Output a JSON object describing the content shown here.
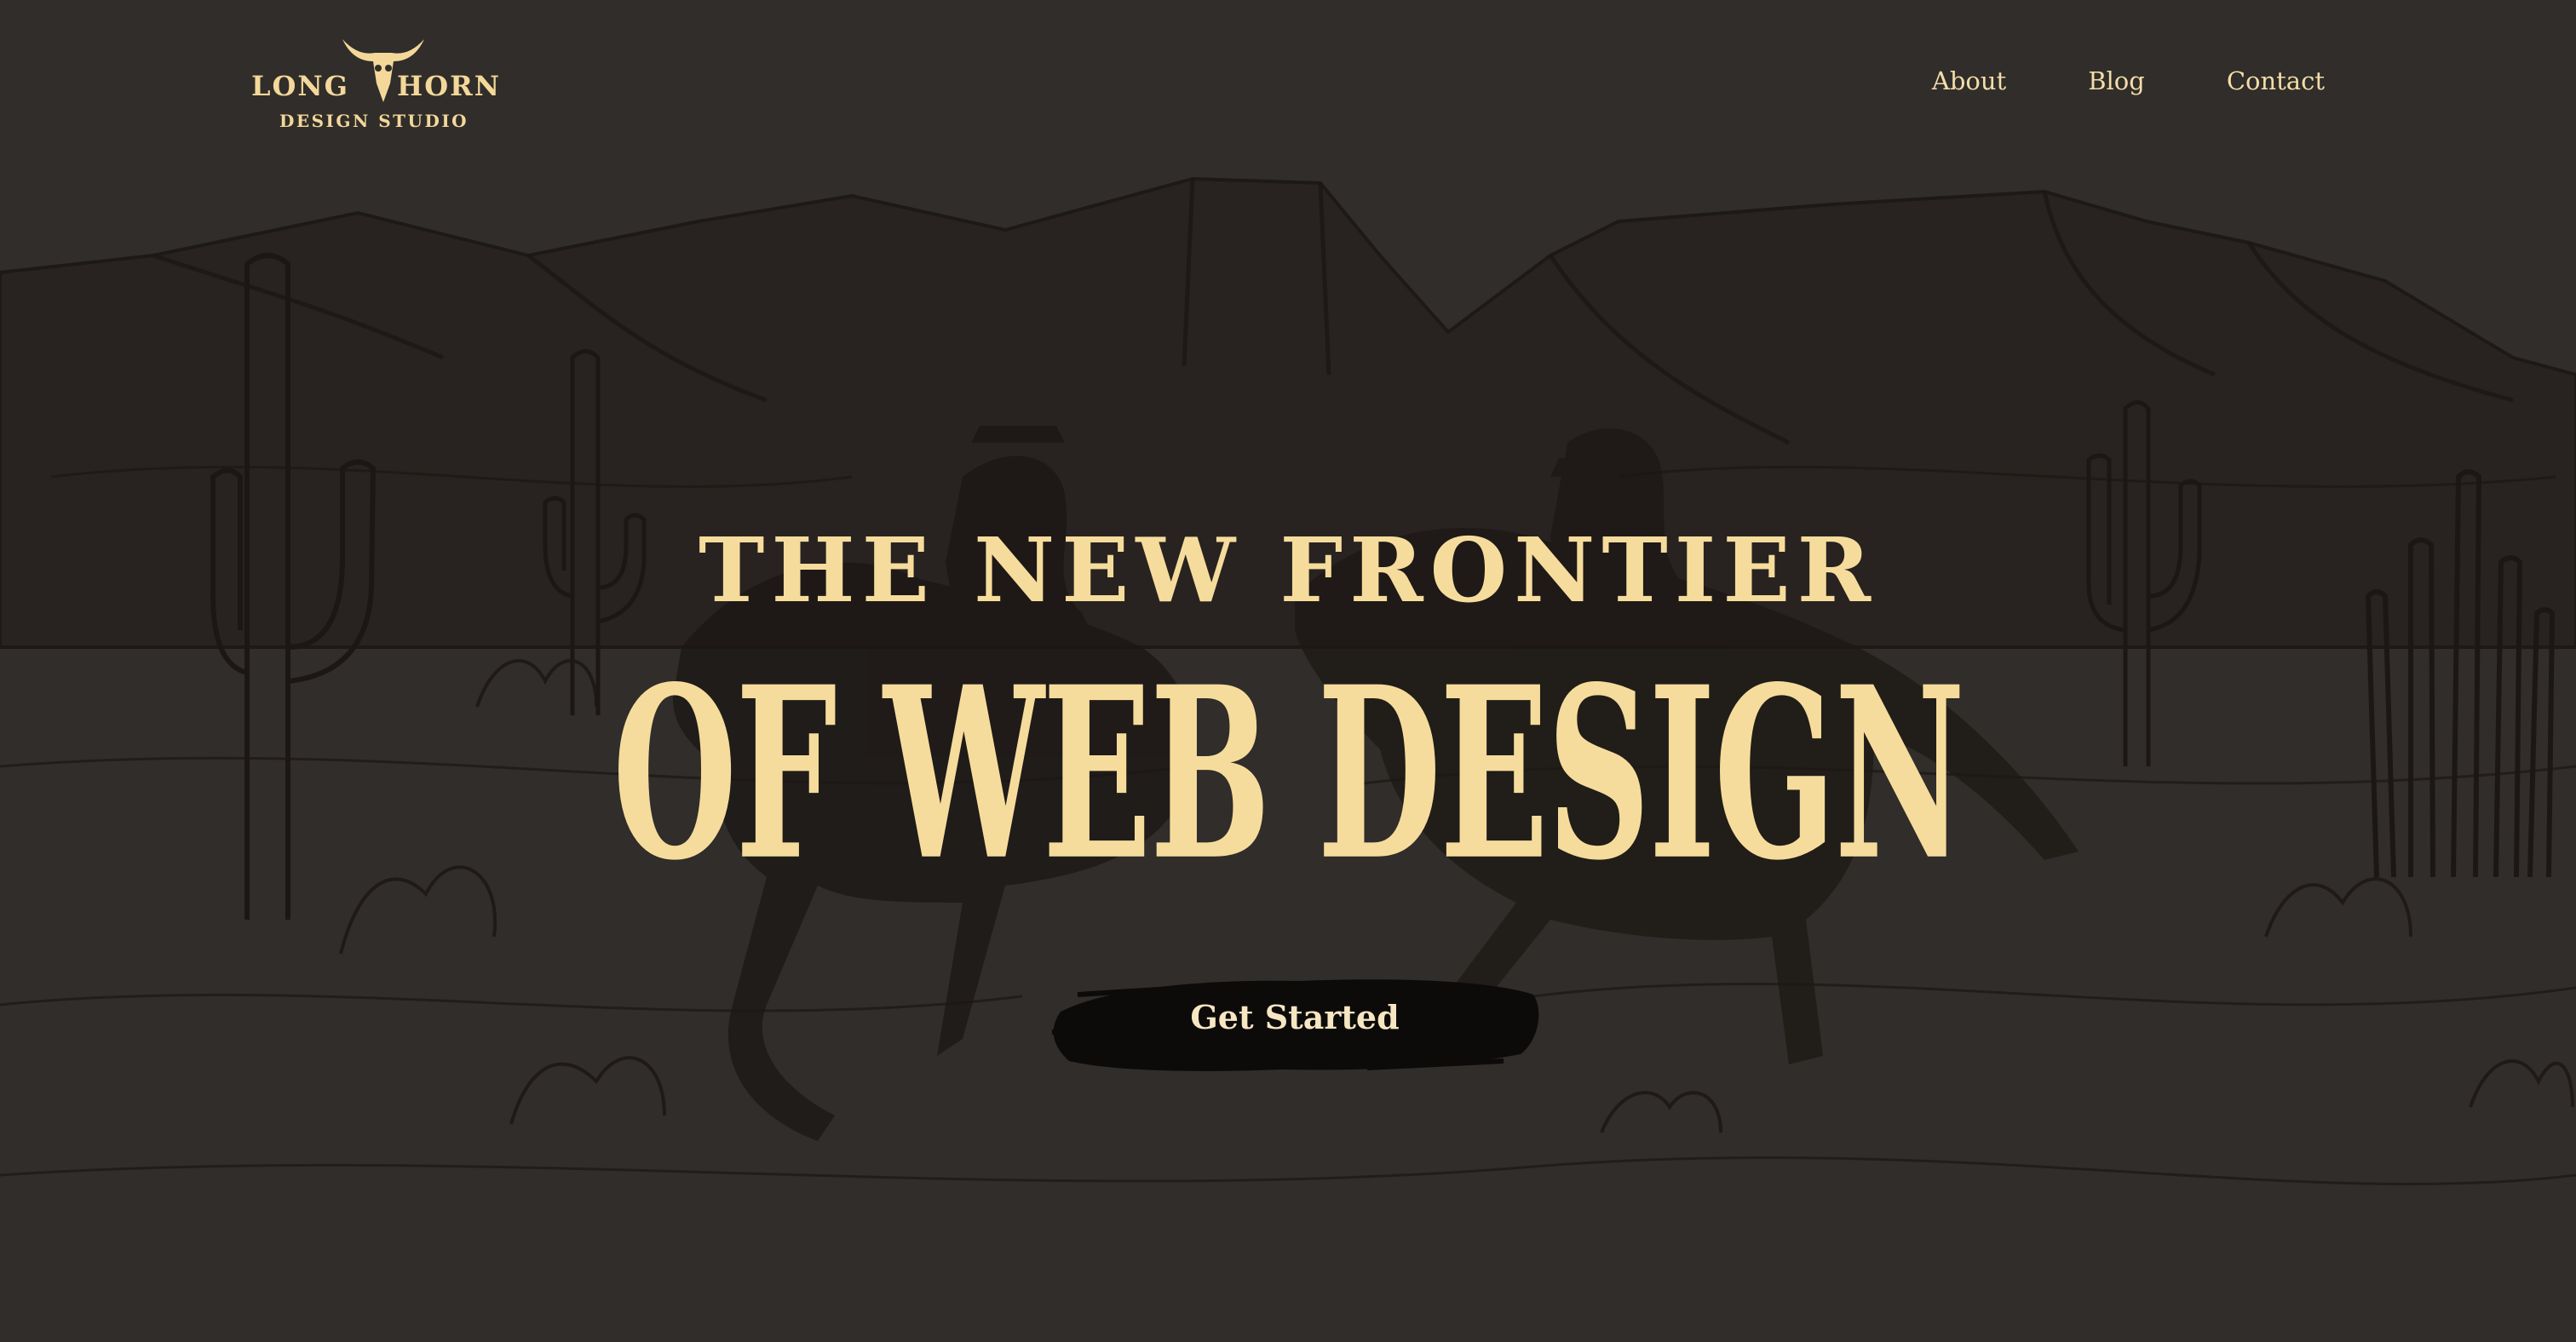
{
  "brand": {
    "word_left": "LONG",
    "word_right": "HORN",
    "subtitle": "DESIGN STUDIO"
  },
  "nav": {
    "items": [
      {
        "label": "About"
      },
      {
        "label": "Blog"
      },
      {
        "label": "Contact"
      }
    ]
  },
  "hero": {
    "line1": "THE NEW FRONTIER",
    "line2": "OF WEB DESIGN",
    "cta_label": "Get Started"
  },
  "colors": {
    "background": "#302d2a",
    "accent": "#f6dc9c",
    "ink": "#1c1714"
  },
  "icons": {
    "logo": "longhorn-skull-icon"
  }
}
